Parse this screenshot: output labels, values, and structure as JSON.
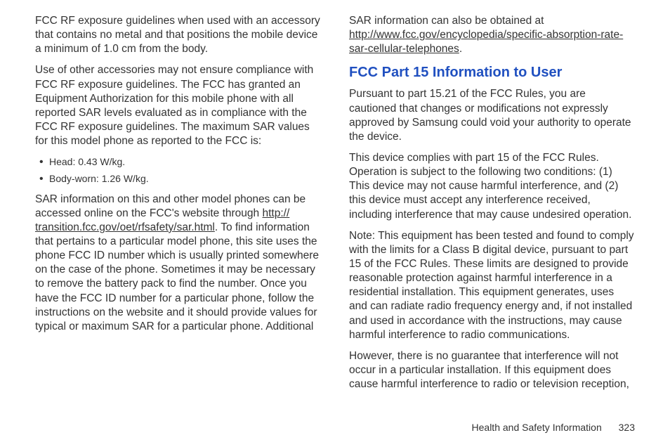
{
  "left_column": {
    "para1": "FCC RF exposure guidelines when used with an accessory that contains no metal and that positions the mobile device a minimum of 1.0 cm from the body.",
    "para2": "Use of other accessories may not ensure compliance with FCC RF exposure guidelines. The FCC has granted an Equipment Authorization for this mobile phone with all reported SAR levels evaluated as in compliance with the FCC RF exposure guidelines. The maximum SAR values for this model phone as reported to the FCC is:",
    "bullet1": "Head: 0.43 W/kg.",
    "bullet2": "Body-worn: 1.26 W/kg.",
    "para3_before_link": "SAR information on this and other model phones can be accessed online on the FCC's website through ",
    "link1": "http:// transition.fcc.gov/oet/rfsafety/sar.html",
    "para3_after_link": ". To find information that pertains to a particular model phone, this site uses the phone FCC ID number which is usually printed somewhere on the case of the phone. Sometimes it may be necessary to remove the battery pack to find the number. Once you have the FCC ID number for a particular phone, follow the instructions on the website and it should provide values for typical or maximum SAR for a particular phone. Additional"
  },
  "right_column": {
    "para1_before_link": "SAR information can also be obtained at ",
    "link2": "http://www.fcc.gov/encyclopedia/specific-absorption-rate-sar-cellular-telephones",
    "para1_after_link": ".",
    "heading": "FCC Part 15 Information to User",
    "para2": "Pursuant to part 15.21 of the FCC Rules, you are cautioned that changes or modifications not expressly approved by Samsung could void your authority to operate the device.",
    "para3": "This device complies with part 15 of the FCC Rules. Operation is subject to the following two conditions: (1) This device may not cause harmful interference, and (2) this device must accept any interference received, including interference that may cause undesired operation.",
    "para4": "Note: This equipment has been tested and found to comply with the limits for a Class B digital device, pursuant to part 15 of the FCC Rules. These limits are designed to provide reasonable protection against harmful interference in a residential installation. This equipment generates, uses and can radiate radio frequency energy and, if not installed and used in accordance with the instructions, may cause harmful interference to radio communications.",
    "para5": "However, there is no guarantee that interference will not occur in a particular installation. If this equipment does cause harmful interference to radio or television reception,"
  },
  "footer": {
    "section_title": "Health and Safety Information",
    "page_number": "323"
  }
}
